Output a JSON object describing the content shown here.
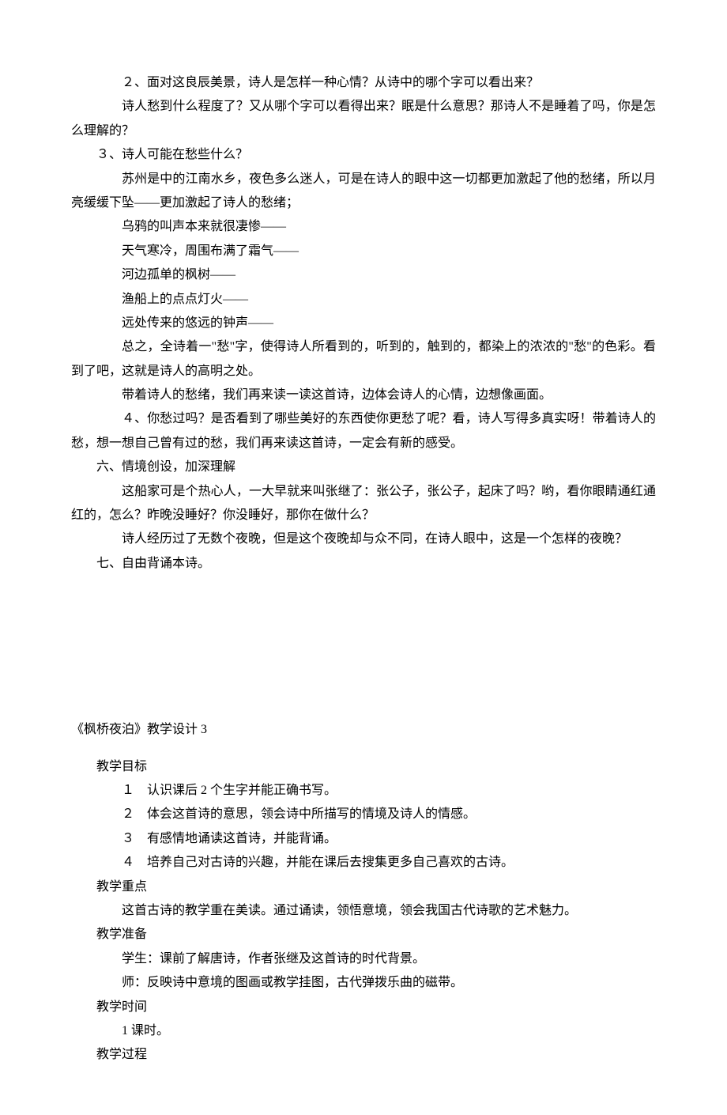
{
  "sec1": {
    "p1": "２、面对这良辰美景，诗人是怎样一种心情？从诗中的哪个字可以看出来？",
    "p2": "诗人愁到什么程度了？又从哪个字可以看得出来？眠是什么意思？那诗人不是睡着了吗，你是怎么理解的？",
    "p3": "３、诗人可能在愁些什么？",
    "p4": "苏州是中的江南水乡，夜色多么迷人，可是在诗人的眼中这一切都更加激起了他的愁绪，所以月亮缓缓下坠——更加激起了诗人的愁绪；",
    "p5": "乌鸦的叫声本来就很凄惨——",
    "p6": "天气寒冷，周围布满了霜气——",
    "p7": "河边孤单的枫树——",
    "p8": "渔船上的点点灯火——",
    "p9": "远处传来的悠远的钟声——",
    "p10": "总之，全诗着一\"愁\"字，使得诗人所看到的，听到的，触到的，都染上的浓浓的\"愁\"的色彩。看到了吧，这就是诗人的高明之处。",
    "p11": "带着诗人的愁绪，我们再来读一读这首诗，边体会诗人的心情，边想像画面。",
    "p12": "４、你愁过吗？是否看到了哪些美好的东西使你更愁了呢？看，诗人写得多真实呀！带着诗人的愁，想一想自己曾有过的愁，我们再来读这首诗，一定会有新的感受。",
    "p13": "六、情境创设，加深理解",
    "p14": "这船家可是个热心人，一大早就来叫张继了：张公子，张公子，起床了吗？哟，看你眼睛通红通红的，怎么？昨晚没睡好？你没睡好，那你在做什么？",
    "p15": "诗人经历过了无数个夜晚，但是这个夜晚却与众不同，在诗人眼中，这是一个怎样的夜晚？",
    "p16": "七、自由背诵本诗。"
  },
  "sec2": {
    "title": "《枫桥夜泊》教学设计 3",
    "h1": "教学目标",
    "g1": "１　认识课后 2 个生字并能正确书写。",
    "g2": "２　体会这首诗的意思，领会诗中所描写的情境及诗人的情感。",
    "g3": "３　有感情地诵读这首诗，并能背诵。",
    "g4": "４　培养自己对古诗的兴趣，并能在课后去搜集更多自己喜欢的古诗。",
    "h2": "教学重点",
    "r1": "这首古诗的教学重在美读。通过诵读，领悟意境，领会我国古代诗歌的艺术魅力。",
    "h3": "教学准备",
    "p1": "学生：课前了解唐诗，作者张继及这首诗的时代背景。",
    "p2": "师：反映诗中意境的图画或教学挂图，古代弹拨乐曲的磁带。",
    "h4": "教学时间",
    "t1": "1 课时。",
    "h5": "教学过程"
  }
}
